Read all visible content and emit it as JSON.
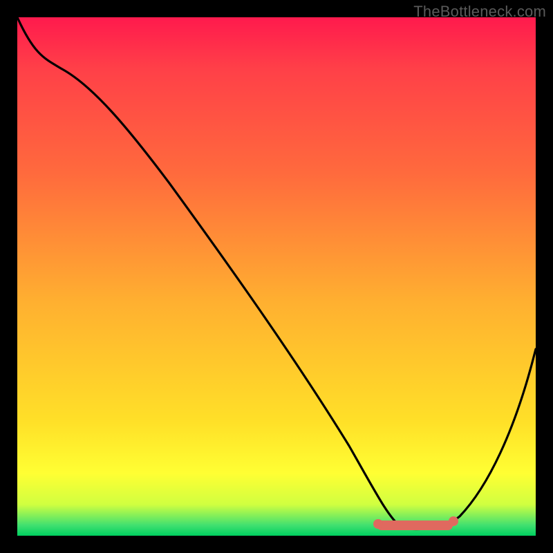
{
  "watermark": "TheBottleneck.com",
  "chart_data": {
    "type": "line",
    "title": "",
    "xlabel": "",
    "ylabel": "",
    "xlim": [
      0,
      100
    ],
    "ylim": [
      0,
      100
    ],
    "series": [
      {
        "name": "curve",
        "x": [
          0,
          3,
          8,
          14,
          22,
          30,
          38,
          46,
          54,
          60,
          65,
          70,
          75,
          80,
          85,
          90,
          95,
          100
        ],
        "values": [
          100,
          96,
          93,
          88,
          80,
          72,
          63,
          54,
          44,
          34,
          24,
          14,
          5,
          2,
          2,
          10,
          24,
          42
        ]
      }
    ],
    "optimal_zone": {
      "x_start": 70,
      "x_end": 82,
      "y": 2
    },
    "colors": {
      "gradient_top": "#ff1a4d",
      "gradient_mid": "#ffe028",
      "gradient_bottom": "#00d060",
      "curve": "#000000",
      "marker": "#e0695f",
      "frame": "#000000"
    }
  }
}
